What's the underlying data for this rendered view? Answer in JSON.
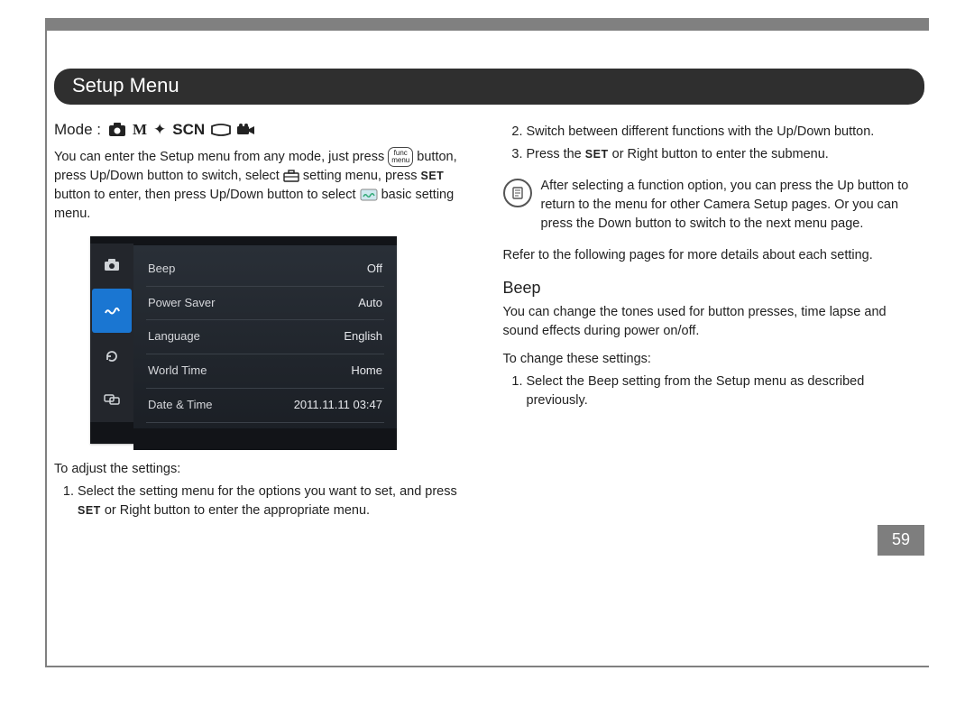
{
  "title": "Setup Menu",
  "mode_label": "Mode :",
  "mode_scn_text": "SCN",
  "intro_parts": {
    "a": "You can enter the Setup menu from any mode, just press ",
    "b": " button, press Up/Down button to switch, select ",
    "c": " setting menu, press ",
    "d": " button to enter, then press Up/Down button to select ",
    "e": " basic setting menu."
  },
  "set_label": "SET",
  "lcd": {
    "rows": [
      {
        "label": "Beep",
        "value": "Off"
      },
      {
        "label": "Power Saver",
        "value": "Auto"
      },
      {
        "label": "Language",
        "value": "English"
      },
      {
        "label": "World Time",
        "value": "Home"
      },
      {
        "label": "Date & Time",
        "value": "2011.11.11 03:47"
      }
    ]
  },
  "adjust_heading": "To adjust the settings:",
  "adjust_item1_a": "Select the setting menu for the options you want to set, and press ",
  "adjust_item1_b": " or Right button to enter the appropriate menu.",
  "right_col": {
    "item2": "Switch between different functions with the Up/Down button.",
    "item3_a": "Press the ",
    "item3_b": " or Right button to enter the submenu.",
    "note": "After selecting a function option, you can press the Up button to return to the menu for other Camera Setup pages. Or you can press the Down button to switch to the next menu page.",
    "refer": "Refer to the following pages for more details about each setting.",
    "beep_heading": "Beep",
    "beep_body": "You can change the tones used for button presses, time lapse and sound effects during power on/off.",
    "beep_change": "To change these settings:",
    "beep_item1": "Select the Beep setting from the Setup menu as described previously."
  },
  "page_number": "59"
}
